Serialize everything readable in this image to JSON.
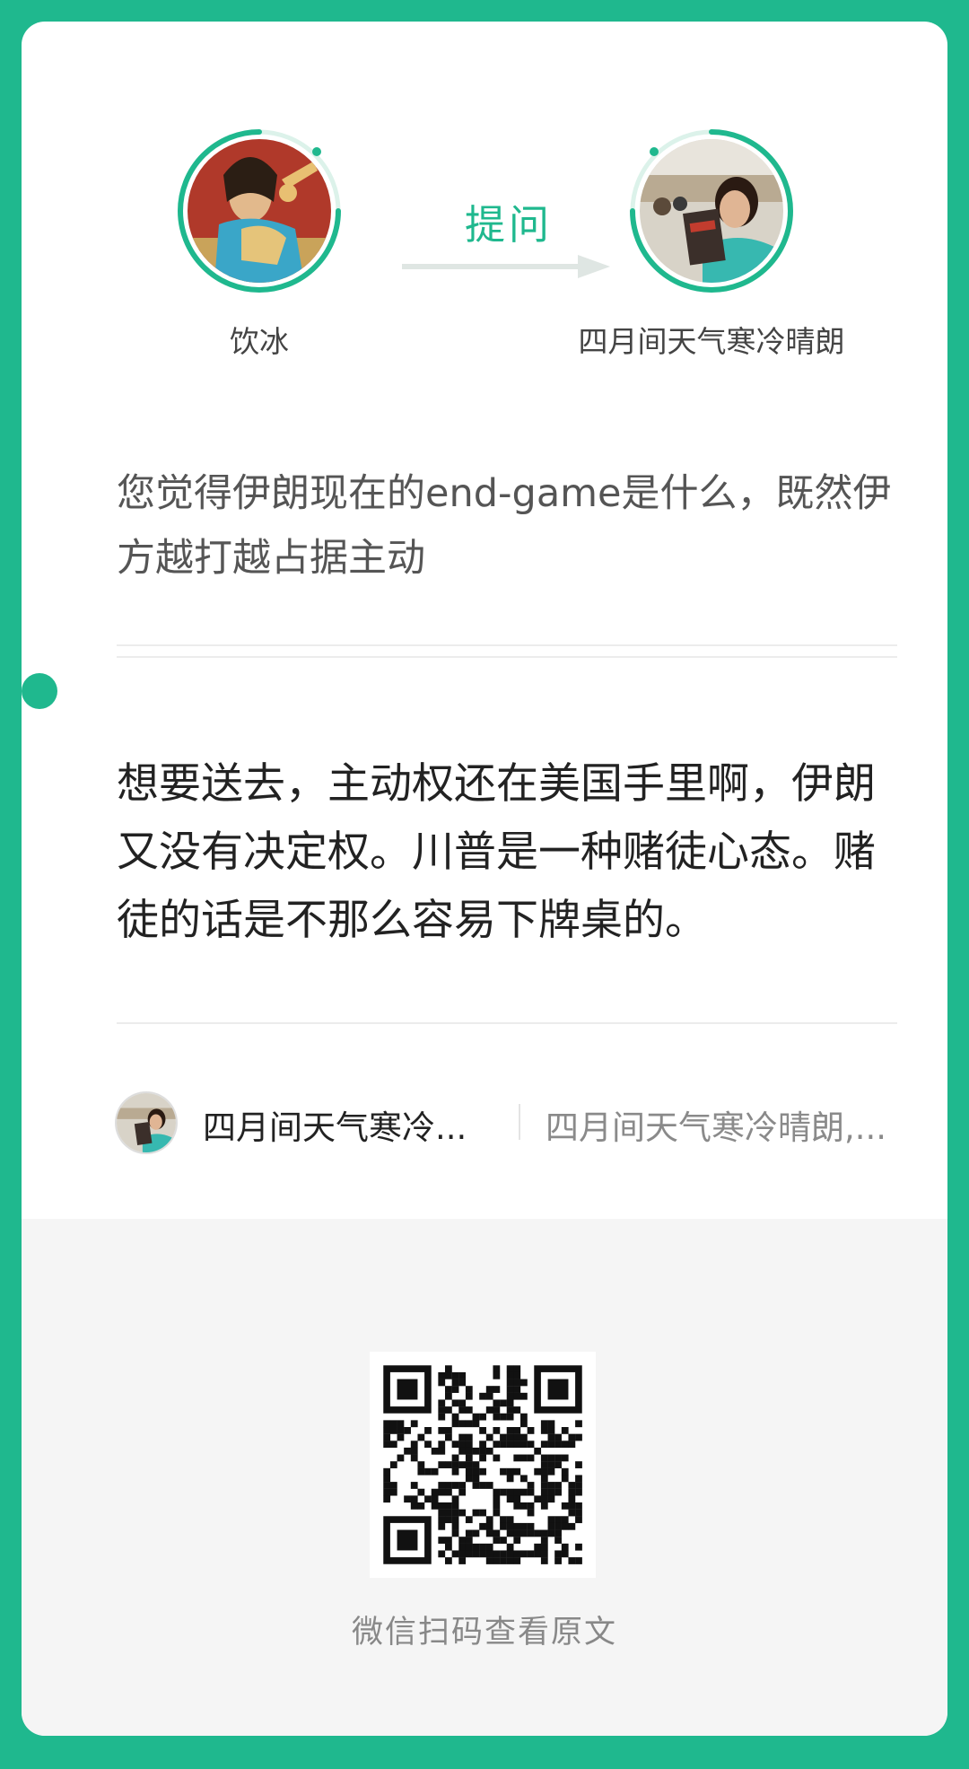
{
  "header": {
    "asker": {
      "name": "饮冰"
    },
    "action_label": "提问",
    "answerer": {
      "name": "四月间天气寒冷晴朗"
    }
  },
  "question": {
    "text": "您觉得伊朗现在的end-game是什么，既然伊方越打越占据主动"
  },
  "answer": {
    "text": "想要送去，主动权还在美国手里啊，伊朗又没有决定权。川普是一种赌徒心态。赌徒的话是不那么容易下牌桌的。"
  },
  "author": {
    "name": "四月间天气寒冷...",
    "description": "四月间天气寒冷晴朗,..."
  },
  "footer": {
    "scan_text": "微信扫码查看原文"
  },
  "colors": {
    "accent": "#1fb88e",
    "card": "#ffffff",
    "footer_bg": "#f5f5f5"
  }
}
